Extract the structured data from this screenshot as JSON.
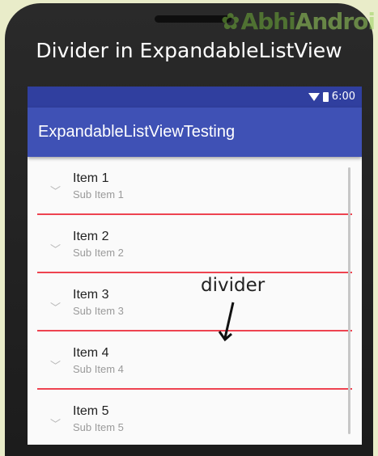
{
  "watermark": {
    "part1": "Abhi",
    "part2": "Androi"
  },
  "headline": "Divider in ExpandableListView",
  "statusbar": {
    "time": "6:00",
    "icons": [
      "wifi-icon",
      "battery-icon"
    ]
  },
  "appbar": {
    "title": "ExpandableListViewTesting",
    "color": "#3f51b5",
    "status_color": "#303f9f"
  },
  "list": {
    "divider_color": "#ee4350",
    "items": [
      {
        "title": "Item 1",
        "subtitle": "Sub Item 1"
      },
      {
        "title": "Item 2",
        "subtitle": "Sub Item 2"
      },
      {
        "title": "Item 3",
        "subtitle": "Sub Item 3"
      },
      {
        "title": "Item 4",
        "subtitle": "Sub Item 4"
      },
      {
        "title": "Item 5",
        "subtitle": "Sub Item 5"
      }
    ]
  },
  "annotation": {
    "label": "divider"
  }
}
